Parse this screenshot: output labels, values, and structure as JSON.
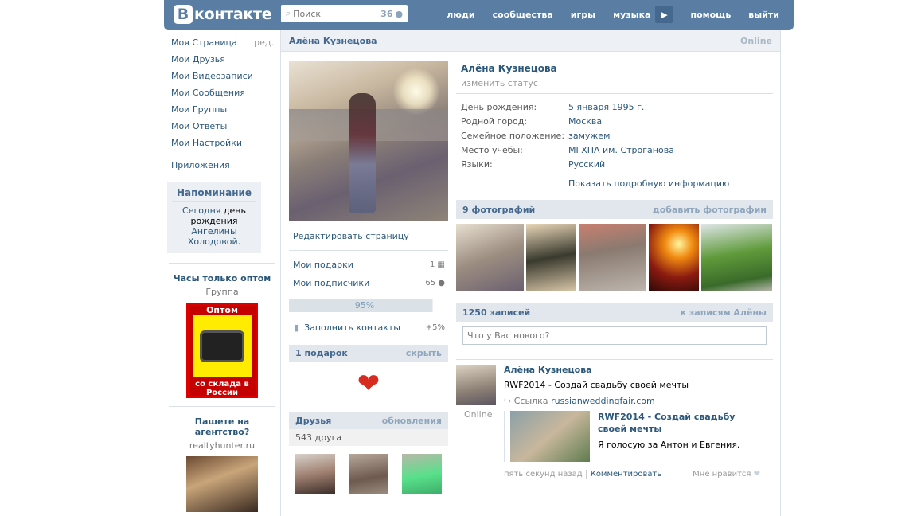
{
  "header": {
    "logo_letter": "B",
    "logo_text": "контакте",
    "search_placeholder": "Поиск",
    "search_count": "36",
    "nav": [
      "люди",
      "сообщества",
      "игры",
      "музыка",
      "помощь",
      "выйти"
    ]
  },
  "sidebar": {
    "menu": [
      {
        "label": "Моя Страница",
        "extra": "ред."
      },
      {
        "label": "Мои Друзья"
      },
      {
        "label": "Мои Видеозаписи"
      },
      {
        "label": "Мои Сообщения"
      },
      {
        "label": "Мои Группы"
      },
      {
        "label": "Мои Ответы"
      },
      {
        "label": "Мои Настройки"
      }
    ],
    "apps": "Приложения",
    "reminder": {
      "title": "Напоминание",
      "today": "Сегодня",
      "text1": " день рождения ",
      "name": "Ангелины Холодовой",
      "dot": "."
    },
    "ad1": {
      "title": "Часы только оптом",
      "subtitle": "Группа",
      "img_top": "Оптом",
      "img_bottom": "со склада в России"
    },
    "ad2": {
      "title": "Пашете на агентство?",
      "subtitle": "realtyhunter.ru"
    }
  },
  "profile": {
    "name": "Алёна Кузнецова",
    "online": "Online",
    "status": "изменить статус",
    "edit": "Редактировать страницу",
    "gifts_label": "Мои подарки",
    "gifts_count": "1",
    "subs_label": "Мои подписчики",
    "subs_count": "65",
    "progress": "95%",
    "progress_value": 0.95,
    "fill_contacts": "Заполнить контакты",
    "fill_bonus": "+5%",
    "gift_block": {
      "title": "1 подарок",
      "action": "скрыть"
    },
    "friends_block": {
      "title": "Друзья",
      "action": "обновления",
      "count": "543 друга"
    },
    "info": [
      {
        "k": "День рождения:",
        "v": "5 января 1995 г."
      },
      {
        "k": "Родной город:",
        "v": "Москва"
      },
      {
        "k": "Семейное положение:",
        "v": "замужем"
      },
      {
        "k": "Место учебы:",
        "v": "МГХПА им. Строганова"
      },
      {
        "k": "Языки:",
        "v": "Русский"
      }
    ],
    "more_info": "Показать подробную информацию",
    "photos": {
      "title": "9 фотографий",
      "action": "добавить фотографии"
    },
    "wall": {
      "title": "1250 записей",
      "action": "к записям Алёны",
      "input_placeholder": "Что у Вас нового?"
    }
  },
  "post": {
    "author": "Алёна Кузнецова",
    "online": "Online",
    "text": "RWF2014 - Создай свадьбу своей мечты",
    "link_prefix": "Ссылка",
    "link": "russianweddingfair.com",
    "att_title": "RWF2014 - Создай свадьбу своей мечты",
    "att_desc": "Я голосую за Антон и Евгения.",
    "time": "пять секунд назад",
    "comment": "Комментировать",
    "like": "Мне нравится"
  }
}
